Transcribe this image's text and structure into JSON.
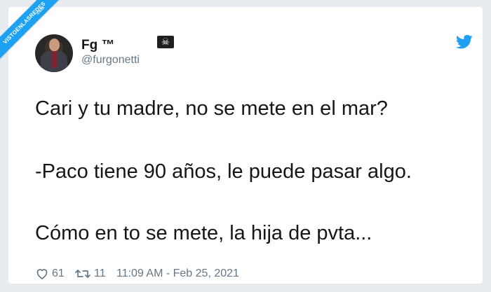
{
  "watermark": {
    "text": "VISTOENLASREDES",
    "suffix": ".com"
  },
  "tweet": {
    "display_name": "Fg ™",
    "name_emoji": "☠",
    "handle": "@furgonetti",
    "lines": [
      "Cari y tu madre, no se mete en el mar?",
      "-Paco tiene 90 años, le puede pasar algo.",
      "Cómo en to se mete, la hija de pvta..."
    ],
    "likes": "61",
    "retweets": "11",
    "timestamp": "11:09 AM - Feb 25, 2021"
  },
  "colors": {
    "twitter_blue": "#1da1f2",
    "text": "#14171a",
    "muted": "#657786",
    "background": "#e8ebef"
  },
  "icons": {
    "avatar": "profile-photo",
    "logo": "twitter-bird-icon",
    "likes": "heart-icon",
    "retweets": "retweet-icon",
    "emoji": "skull-and-crossbones-icon"
  }
}
